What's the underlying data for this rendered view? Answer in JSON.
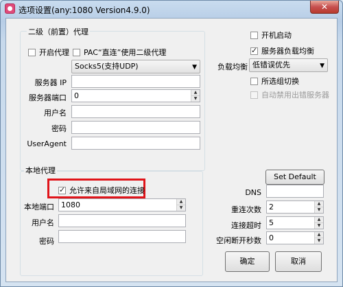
{
  "window": {
    "title": "选项设置(any:1080 Version4.9.0)",
    "close_glyph": "✕"
  },
  "upstream": {
    "group_title": "二级（前置）代理",
    "enable_proxy": {
      "label": "开启代理",
      "checked": false
    },
    "pac_direct": {
      "label": "PAC“直连”使用二级代理",
      "checked": false
    },
    "protocol": {
      "selected": "Socks5(支持UDP)"
    },
    "server_ip": {
      "label": "服务器 IP",
      "value": ""
    },
    "server_port": {
      "label": "服务器端口",
      "value": "0"
    },
    "username": {
      "label": "用户名",
      "value": ""
    },
    "password": {
      "label": "密码",
      "value": ""
    },
    "useragent": {
      "label": "UserAgent",
      "value": ""
    }
  },
  "options": {
    "autostart": {
      "label": "开机启动",
      "checked": false
    },
    "load_balance": {
      "label": "服务器负载均衡",
      "checked": true
    },
    "balance_mode_label": "负载均衡",
    "balance_mode": {
      "selected": "低错误优先"
    },
    "group_switch": {
      "label": "所选组切换",
      "checked": false
    },
    "auto_disable": {
      "label": "自动禁用出错服务器",
      "checked": false,
      "disabled": true
    }
  },
  "local": {
    "group_title": "本地代理",
    "allow_lan": {
      "label": "允许来自局域网的连接",
      "checked": true
    },
    "port": {
      "label": "本地端口",
      "value": "1080"
    },
    "username": {
      "label": "用户名",
      "value": ""
    },
    "password": {
      "label": "密码",
      "value": ""
    }
  },
  "advanced": {
    "set_default": "Set Default",
    "dns": {
      "label": "DNS",
      "value": ""
    },
    "retry": {
      "label": "重连次数",
      "value": "2"
    },
    "timeout": {
      "label": "连接超时",
      "value": "5"
    },
    "idle_disconnect": {
      "label": "空闲断开秒数",
      "value": "0"
    }
  },
  "buttons": {
    "ok": "确定",
    "cancel": "取消"
  },
  "colors": {
    "highlight": "#e0141a",
    "close_button": "#c75050"
  }
}
